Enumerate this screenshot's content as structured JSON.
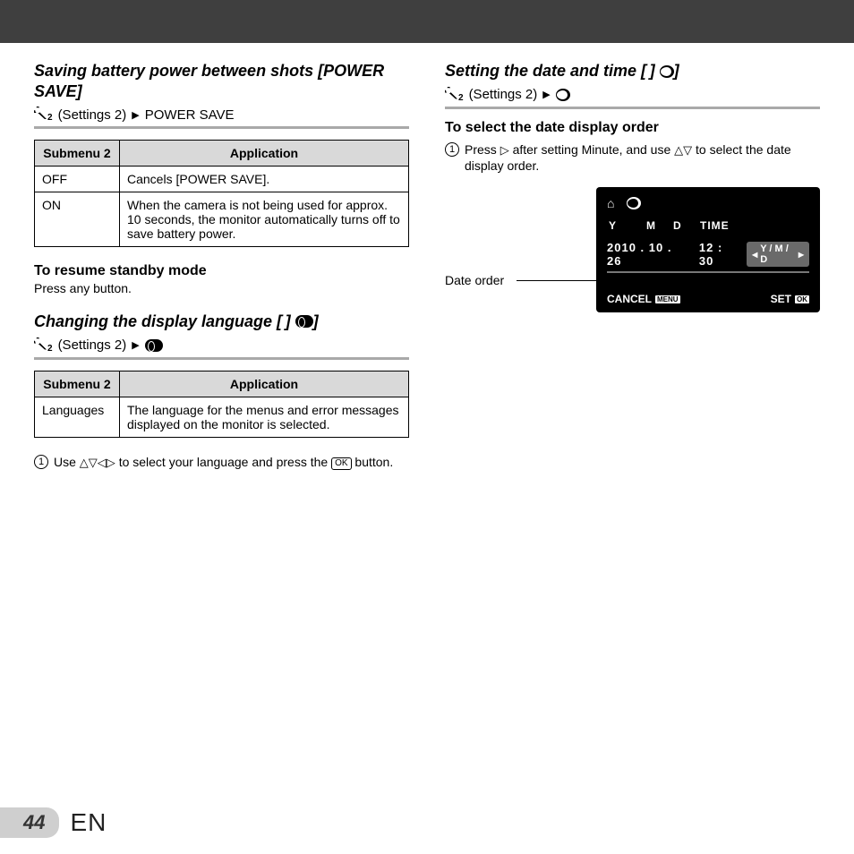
{
  "page_number": "44",
  "page_lang": "EN",
  "left": {
    "section1_title": "Saving battery power between shots [POWER SAVE]",
    "crumb1_settings": "(Settings 2)",
    "crumb1_target": "POWER SAVE",
    "table1": {
      "th1": "Submenu 2",
      "th2": "Application",
      "rows": [
        {
          "c1": "OFF",
          "c2": "Cancels [POWER SAVE]."
        },
        {
          "c1": "ON",
          "c2": "When the camera is not being used for approx. 10 seconds, the monitor automatically turns off to save battery power."
        }
      ]
    },
    "resume_h": "To resume standby mode",
    "resume_p": "Press any button.",
    "section2_title": "Changing the display language [ ]",
    "crumb2_settings": "(Settings 2)",
    "table2": {
      "th1": "Submenu 2",
      "th2": "Application",
      "rows": [
        {
          "c1": "Languages",
          "c2": "The language for the menus and error messages displayed on the monitor is selected."
        }
      ]
    },
    "step1_a": "Use ",
    "step1_b": " to select your language and press the ",
    "step1_c": " button.",
    "ok": "OK"
  },
  "right": {
    "section_title": "Setting the date and time [ ]",
    "crumb_settings": "(Settings 2)",
    "select_h": "To select the date display order",
    "step_a": "Press ",
    "step_b": " after setting Minute, and use ",
    "step_c": " to select the date display order.",
    "label_date_order": "Date order",
    "lcd": {
      "hdr_y": "Y",
      "hdr_m": "M",
      "hdr_d": "D",
      "hdr_t": "TIME",
      "date": "2010 . 10 . 26",
      "time": "12 : 30",
      "order": "Y / M / D",
      "cancel": "CANCEL",
      "menu": "MENU",
      "set": "SET",
      "ok": "OK"
    }
  }
}
